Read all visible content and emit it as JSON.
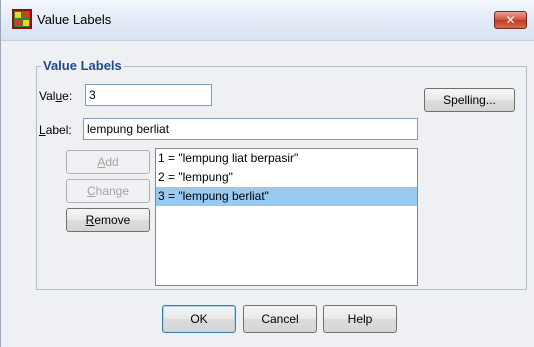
{
  "window": {
    "title": "Value Labels",
    "close_symbol": "✕"
  },
  "group": {
    "legend": "Value Labels"
  },
  "value_field": {
    "label_prefix": "Val",
    "label_mnemonic": "u",
    "label_suffix": "e:",
    "value": "3"
  },
  "label_field": {
    "label_mnemonic": "L",
    "label_suffix": "abel:",
    "value": "lempung berliat"
  },
  "buttons": {
    "spelling": "Spelling...",
    "add_mnemonic": "A",
    "add_rest": "dd",
    "change_mnemonic": "C",
    "change_rest": "hange",
    "remove_mnemonic": "R",
    "remove_rest": "emove",
    "ok": "OK",
    "cancel": "Cancel",
    "help": "Help"
  },
  "value_list": [
    "1 = \"lempung liat berpasir\"",
    "2 = \"lempung\"",
    "3 = \"lempung berliat\""
  ],
  "selected_index": 2
}
